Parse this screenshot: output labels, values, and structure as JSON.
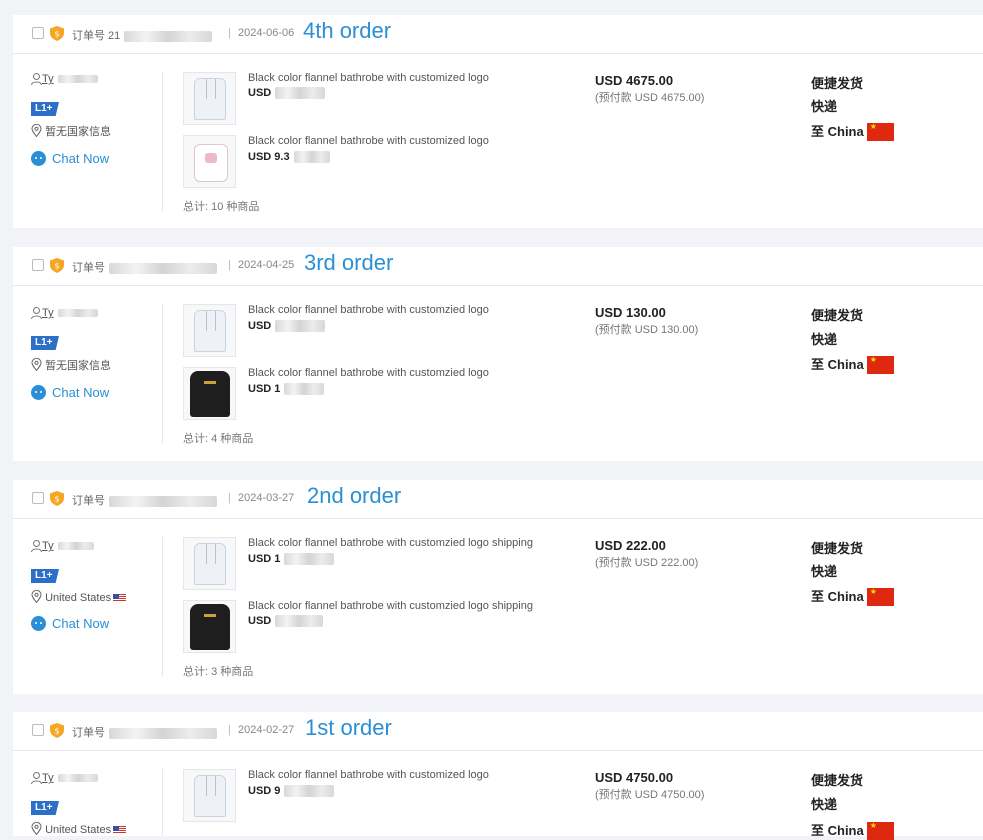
{
  "orders": [
    {
      "annotation": "4th order",
      "order_label": "订单号 21",
      "order_tail": "2",
      "date": "2024-06-06",
      "buyer": {
        "name": "Ty",
        "level": "L1+",
        "location": "暂无国家信息",
        "chat": "Chat Now"
      },
      "products": [
        {
          "title": "Black color flannel bathrobe with customized logo",
          "price": "USD",
          "image": "white-robe"
        },
        {
          "title": "Black color flannel bathrobe with customized logo",
          "price": "USD 9.3",
          "image": "pink-robe"
        }
      ],
      "total": "总计: 10 种商品",
      "amount": "USD 4675.00",
      "prepay": "(预付款 USD 4675.00)",
      "ship_method": "便捷发货",
      "ship_type": "快递",
      "ship_dest": "至 China"
    },
    {
      "annotation": "3rd order",
      "order_label": "订单号",
      "order_tail": "",
      "date": "2024-04-25",
      "buyer": {
        "name": "Ty",
        "level": "L1+",
        "location": "暂无国家信息",
        "chat": "Chat Now"
      },
      "products": [
        {
          "title": "Black color flannel bathrobe with customzied logo",
          "price": "USD",
          "image": "white-robe"
        },
        {
          "title": "Black color flannel bathrobe with customzied logo",
          "price": "USD 1",
          "image": "black-robe"
        }
      ],
      "total": "总计: 4 种商品",
      "amount": "USD 130.00",
      "prepay": "(预付款 USD 130.00)",
      "ship_method": "便捷发货",
      "ship_type": "快递",
      "ship_dest": "至 China"
    },
    {
      "annotation": "2nd order",
      "order_label": "订单号",
      "order_tail": "",
      "date": "2024-03-27",
      "buyer": {
        "name": "Ty",
        "level": "L1+",
        "location": "United States",
        "chat": "Chat Now"
      },
      "products": [
        {
          "title": "Black color flannel bathrobe with customzied logo shipping",
          "price": "USD 1",
          "image": "white-robe"
        },
        {
          "title": "Black color flannel bathrobe with customzied logo shipping",
          "price": "USD",
          "image": "black-robe"
        }
      ],
      "total": "总计: 3 种商品",
      "amount": "USD 222.00",
      "prepay": "(预付款 USD 222.00)",
      "ship_method": "便捷发货",
      "ship_type": "快递",
      "ship_dest": "至 China"
    },
    {
      "annotation": "1st order",
      "order_label": "订单号",
      "order_tail": "",
      "date": "2024-02-27",
      "buyer": {
        "name": "Ty",
        "level": "L1+",
        "location": "United States",
        "chat": "Chat Now"
      },
      "products": [
        {
          "title": "Black color flannel bathrobe with customized logo",
          "price": "USD 9",
          "image": "white-robe"
        }
      ],
      "total": "",
      "amount": "USD 4750.00",
      "prepay": "(预付款 USD 4750.00)",
      "ship_method": "便捷发货",
      "ship_type": "快递",
      "ship_dest": "至 China"
    }
  ],
  "colors": {
    "accent": "#2a8fd4",
    "badge": "#2d6ec9",
    "background": "#f2f3f7"
  }
}
